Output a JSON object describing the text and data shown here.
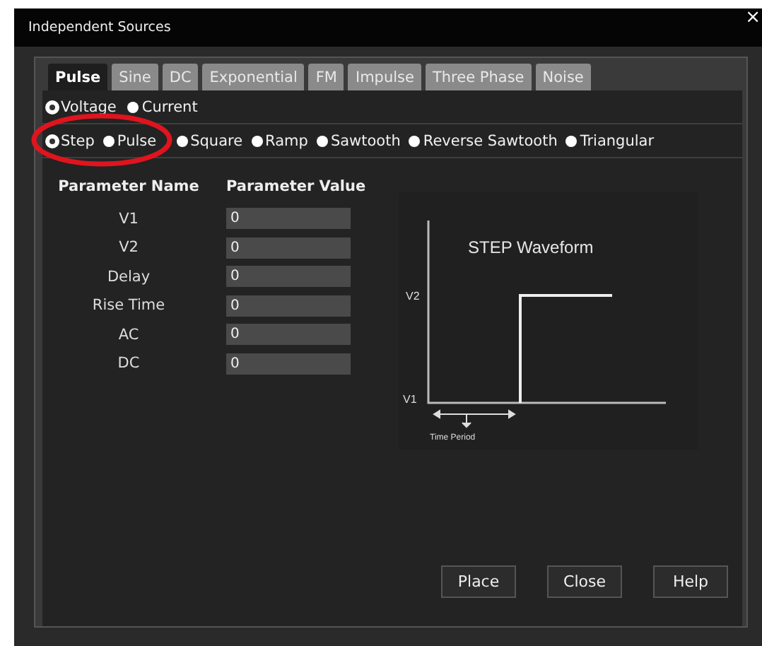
{
  "window": {
    "title": "Independent Sources",
    "close": "×"
  },
  "tabs": [
    {
      "label": "Pulse",
      "selected": true
    },
    {
      "label": "Sine",
      "selected": false
    },
    {
      "label": "DC",
      "selected": false
    },
    {
      "label": "Exponential",
      "selected": false
    },
    {
      "label": "FM",
      "selected": false
    },
    {
      "label": "Impulse",
      "selected": false
    },
    {
      "label": "Three Phase",
      "selected": false
    },
    {
      "label": "Noise",
      "selected": false
    }
  ],
  "source_type": [
    {
      "label": "Voltage",
      "selected": true
    },
    {
      "label": "Current",
      "selected": false
    }
  ],
  "waveform_type": [
    {
      "label": "Step",
      "selected": true
    },
    {
      "label": "Pulse",
      "selected": false
    },
    {
      "label": "Square",
      "selected": false
    },
    {
      "label": "Ramp",
      "selected": false
    },
    {
      "label": "Sawtooth",
      "selected": false
    },
    {
      "label": "Reverse Sawtooth",
      "selected": false
    },
    {
      "label": "Triangular",
      "selected": false
    }
  ],
  "annotation": {
    "kind": "ellipse",
    "color": "#e0141e"
  },
  "parameters": {
    "columns": [
      "Parameter Name",
      "Parameter Value"
    ],
    "rows": [
      {
        "name": "V1",
        "value": "0"
      },
      {
        "name": "V2",
        "value": "0"
      },
      {
        "name": "Delay",
        "value": "0"
      },
      {
        "name": "Rise Time",
        "value": "0"
      },
      {
        "name": "AC",
        "value": "0"
      },
      {
        "name": "DC",
        "value": "0"
      }
    ]
  },
  "diagram": {
    "title": "STEP Waveform",
    "high_label": "V2",
    "low_label": "V1",
    "period_label": "Time Period"
  },
  "buttons": [
    "Place",
    "Close",
    "Help"
  ]
}
